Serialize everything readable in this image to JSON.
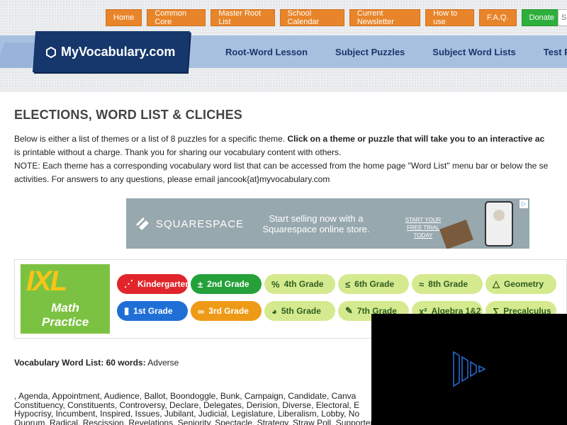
{
  "top_nav": {
    "items": [
      "Home",
      "Common Core",
      "Master Root List",
      "School Calendar",
      "Current Newsletter",
      "How to use",
      "F.A.Q.",
      "Donate"
    ],
    "search_placeholder": "S"
  },
  "logo": {
    "text": "MyVocabulary.com",
    "icon": "hexagon-icon"
  },
  "main_nav": {
    "items": [
      "Root-Word Lesson",
      "Subject Puzzles",
      "Subject Word Lists",
      "Test Pre"
    ]
  },
  "page": {
    "title": "ELECTIONS, WORD LIST & CLICHES",
    "intro_1": "Below is either a list of themes or a list of 8 puzzles for a specific theme. ",
    "intro_1_bold": "Click on a theme or puzzle that will take you to an interactive ac",
    "intro_2": "is printable without a charge. Thank you for sharing our vocabulary content with others.",
    "intro_3": "NOTE: Each theme has a corresponding vocabulary word list that can be accessed from the home page \"Word List\" menu bar or below the se",
    "intro_4": "activities. For answers to any questions, please email jancook{at}myvocabulary.com"
  },
  "ad_squarespace": {
    "brand": "SQUARESPACE",
    "headline": "Start selling now with a Squarespace online store.",
    "cta": "START YOUR FREE TRIAL TODAY",
    "badge": "▷"
  },
  "ad_ixl": {
    "logo": "IXL",
    "sub_1": "Math",
    "sub_2": "Practice",
    "grades": [
      {
        "label": "Kindergarten",
        "icon": "⋰",
        "bg": "#e0262b",
        "fg": "#ffffff"
      },
      {
        "label": "2nd Grade",
        "icon": "±",
        "bg": "#26a13a",
        "fg": "#ffffff"
      },
      {
        "label": "4th Grade",
        "icon": "%",
        "bg": "#d5ea8f",
        "fg": "#2d5e1e"
      },
      {
        "label": "6th Grade",
        "icon": "≤",
        "bg": "#d5ea8f",
        "fg": "#2d5e1e"
      },
      {
        "label": "8th Grade",
        "icon": "≈",
        "bg": "#d5ea8f",
        "fg": "#2d5e1e"
      },
      {
        "label": "Geometry",
        "icon": "△",
        "bg": "#d5ea8f",
        "fg": "#2d5e1e"
      },
      {
        "label": "1st Grade",
        "icon": "▮",
        "bg": "#1f6fd6",
        "fg": "#ffffff"
      },
      {
        "label": "3rd Grade",
        "icon": "∞",
        "bg": "#ef9a16",
        "fg": "#ffffff"
      },
      {
        "label": "5th Grade",
        "icon": "◕",
        "bg": "#d5ea8f",
        "fg": "#2d5e1e"
      },
      {
        "label": "7th Grade",
        "icon": "✎",
        "bg": "#d5ea8f",
        "fg": "#2d5e1e"
      },
      {
        "label": "Algebra 1&2",
        "icon": "x²",
        "bg": "#d5ea8f",
        "fg": "#2d5e1e"
      },
      {
        "label": "Precalculus",
        "icon": "∑",
        "bg": "#d5ea8f",
        "fg": "#2d5e1e"
      }
    ]
  },
  "vocab": {
    "label": "Vocabulary Word List: 60 words:",
    "first_word": " Adverse",
    "line_1": ", Agenda, Appointment, Audience, Ballot, Boondoggle, Bunk, Campaign, Candidate, Canva",
    "line_2": "Constituency, Constituents, Controversy, Declare, Delegates, Derision, Diverse, Electoral, E",
    "line_3": "Hypocrisy, Incumbent, Inspired, Issues, Jubilant, Judicial, Legislature, Liberalism, Lobby, No",
    "line_4": "Quorum, Radical, Rescission, Revelations, Seniority, Spectacle, Strategy, Straw Poll, Supporter, Tenure, Term, Unity, Veto, Vote"
  },
  "colors": {
    "orange_button": "#e8852a",
    "donate_green": "#2eae3b",
    "nav_blue": "#a8c0e0",
    "logo_navy": "#15376b"
  }
}
